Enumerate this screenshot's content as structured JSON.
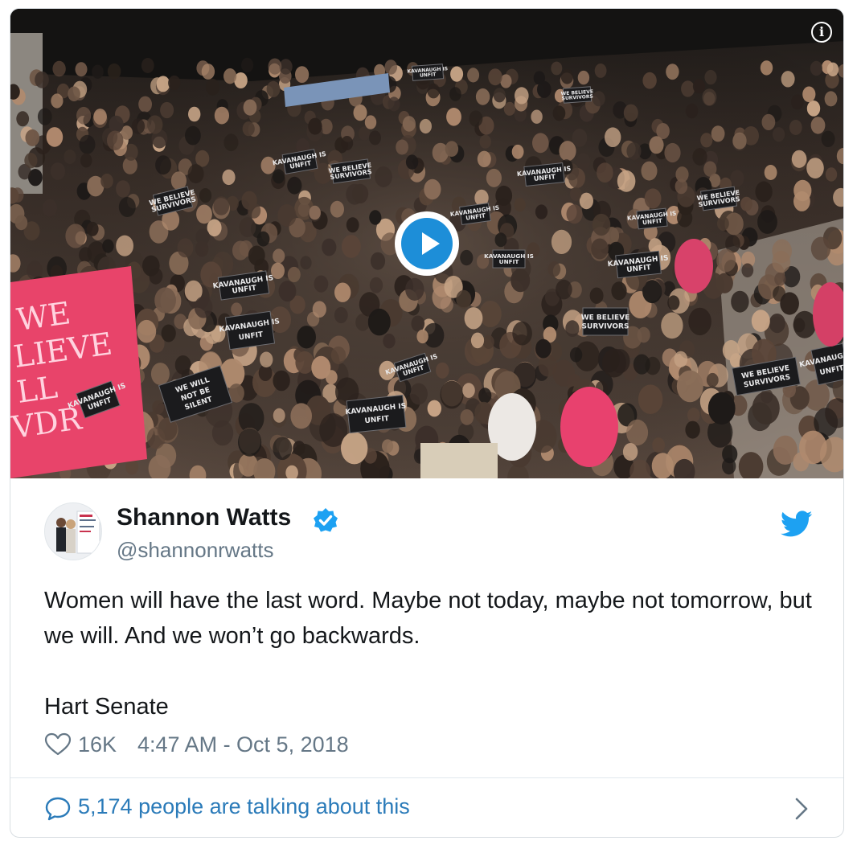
{
  "media": {
    "sign_texts": [
      "WE WILL NOT BE SILENT",
      "WE BELIEVE SURVIVORS",
      "KAVANAUGH IS UNFIT"
    ]
  },
  "tweet": {
    "author_name": "Shannon Watts",
    "handle": "@shannonrwatts",
    "text_line1": "Women will have the last word. Maybe not today, maybe not tomorrow, but we will. And we won’t go backwards.",
    "text_line2": "Hart Senate",
    "likes": "16K",
    "timestamp": "4:47 AM - Oct 5, 2018",
    "talking": "5,174 people are talking about this"
  },
  "colors": {
    "brand_blue": "#1da1f2",
    "link_blue": "#2b7bb9",
    "text_primary": "#14171a",
    "text_secondary": "#657786",
    "play_blue": "#1d8ed8"
  },
  "icons": {
    "info": "info-icon",
    "play": "play-icon",
    "verified": "verified-badge-icon",
    "bird": "twitter-bird-icon",
    "heart": "heart-icon",
    "chat": "speech-bubble-icon",
    "chevron": "chevron-right-icon"
  }
}
